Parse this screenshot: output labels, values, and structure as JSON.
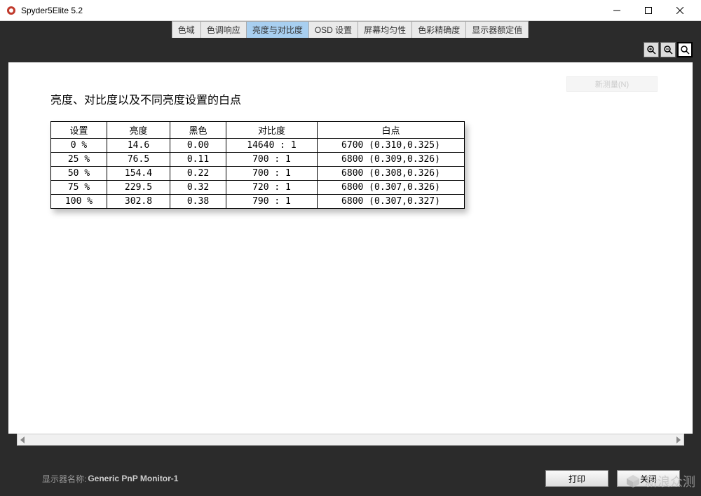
{
  "window": {
    "title": "Spyder5Elite 5.2"
  },
  "tabs": [
    {
      "label": "色域"
    },
    {
      "label": "色调响应"
    },
    {
      "label": "亮度与对比度",
      "active": true
    },
    {
      "label": "OSD 设置"
    },
    {
      "label": "屏幕均匀性"
    },
    {
      "label": "色彩精确度"
    },
    {
      "label": "显示器额定值"
    }
  ],
  "content": {
    "heading": "亮度、对比度以及不同亮度设置的白点",
    "ghost_button": "新测量(N)",
    "table": {
      "headers": [
        "设置",
        "亮度",
        "黑色",
        "对比度",
        "白点"
      ],
      "rows": [
        {
          "setting": "0 %",
          "brightness": "14.6",
          "black": "0.00",
          "contrast": "14640 : 1",
          "whitepoint": "6700 (0.310,0.325)"
        },
        {
          "setting": "25 %",
          "brightness": "76.5",
          "black": "0.11",
          "contrast": "700 : 1",
          "whitepoint": "6800 (0.309,0.326)"
        },
        {
          "setting": "50 %",
          "brightness": "154.4",
          "black": "0.22",
          "contrast": "700 : 1",
          "whitepoint": "6800 (0.308,0.326)"
        },
        {
          "setting": "75 %",
          "brightness": "229.5",
          "black": "0.32",
          "contrast": "720 : 1",
          "whitepoint": "6800 (0.307,0.326)"
        },
        {
          "setting": "100 %",
          "brightness": "302.8",
          "black": "0.38",
          "contrast": "790 : 1",
          "whitepoint": "6800 (0.307,0.327)"
        }
      ]
    }
  },
  "footer": {
    "monitor_label": "显示器名称:",
    "monitor_value": "Generic PnP Monitor-1",
    "print_label": "打印",
    "close_label": "关闭"
  },
  "watermark": {
    "text": "新浪众测"
  },
  "chart_data": {
    "type": "table",
    "title": "亮度、对比度以及不同亮度设置的白点",
    "columns": [
      "设置",
      "亮度",
      "黑色",
      "对比度",
      "白点"
    ],
    "rows": [
      [
        "0 %",
        14.6,
        0.0,
        "14640 : 1",
        "6700 (0.310,0.325)"
      ],
      [
        "25 %",
        76.5,
        0.11,
        "700 : 1",
        "6800 (0.309,0.326)"
      ],
      [
        "50 %",
        154.4,
        0.22,
        "700 : 1",
        "6800 (0.308,0.326)"
      ],
      [
        "75 %",
        229.5,
        0.32,
        "720 : 1",
        "6800 (0.307,0.326)"
      ],
      [
        "100 %",
        302.8,
        0.38,
        "790 : 1",
        "6800 (0.307,0.327)"
      ]
    ]
  }
}
